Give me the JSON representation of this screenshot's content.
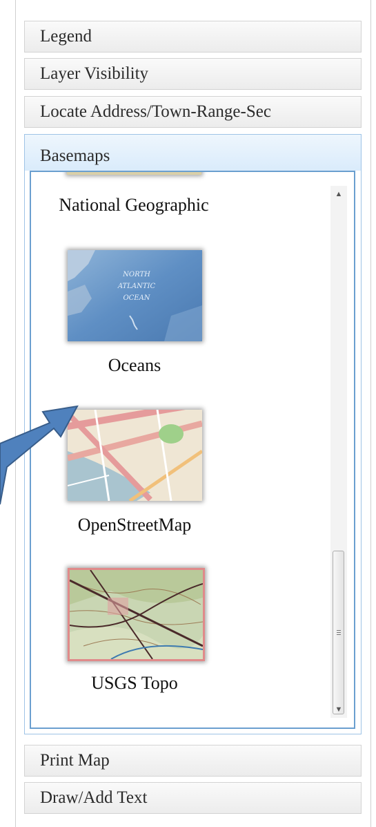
{
  "accordion": {
    "sections": [
      {
        "label": "Legend"
      },
      {
        "label": "Layer Visibility"
      },
      {
        "label": "Locate Address/Town-Range-Sec"
      },
      {
        "label": "Basemaps"
      }
    ],
    "bottom_sections": [
      {
        "label": "Print Map"
      },
      {
        "label": "Draw/Add Text"
      }
    ],
    "active": "Basemaps"
  },
  "basemaps": {
    "items": [
      {
        "label": "National Geographic",
        "thumbnail_icon": "national-geographic-map-thumbnail"
      },
      {
        "label": "Oceans",
        "thumbnail_icon": "oceans-map-thumbnail"
      },
      {
        "label": "OpenStreetMap",
        "thumbnail_icon": "openstreetmap-thumbnail"
      },
      {
        "label": "USGS Topo",
        "thumbnail_icon": "usgs-topo-thumbnail",
        "selected": true
      }
    ],
    "oceans_map_text": [
      "NORTH",
      "ATLANTIC",
      "OCEAN"
    ],
    "selected_border_color": "#e08a8a"
  },
  "scrollbar": {
    "up_glyph": "▲",
    "down_glyph": "▼",
    "position_fraction": 0.66
  },
  "colors": {
    "header_bg": "#ececec",
    "active_header_bg": "#d9ebfb",
    "active_border": "#6a9fcf",
    "arrow_fill": "#4f81bd",
    "arrow_stroke": "#385d8a"
  }
}
